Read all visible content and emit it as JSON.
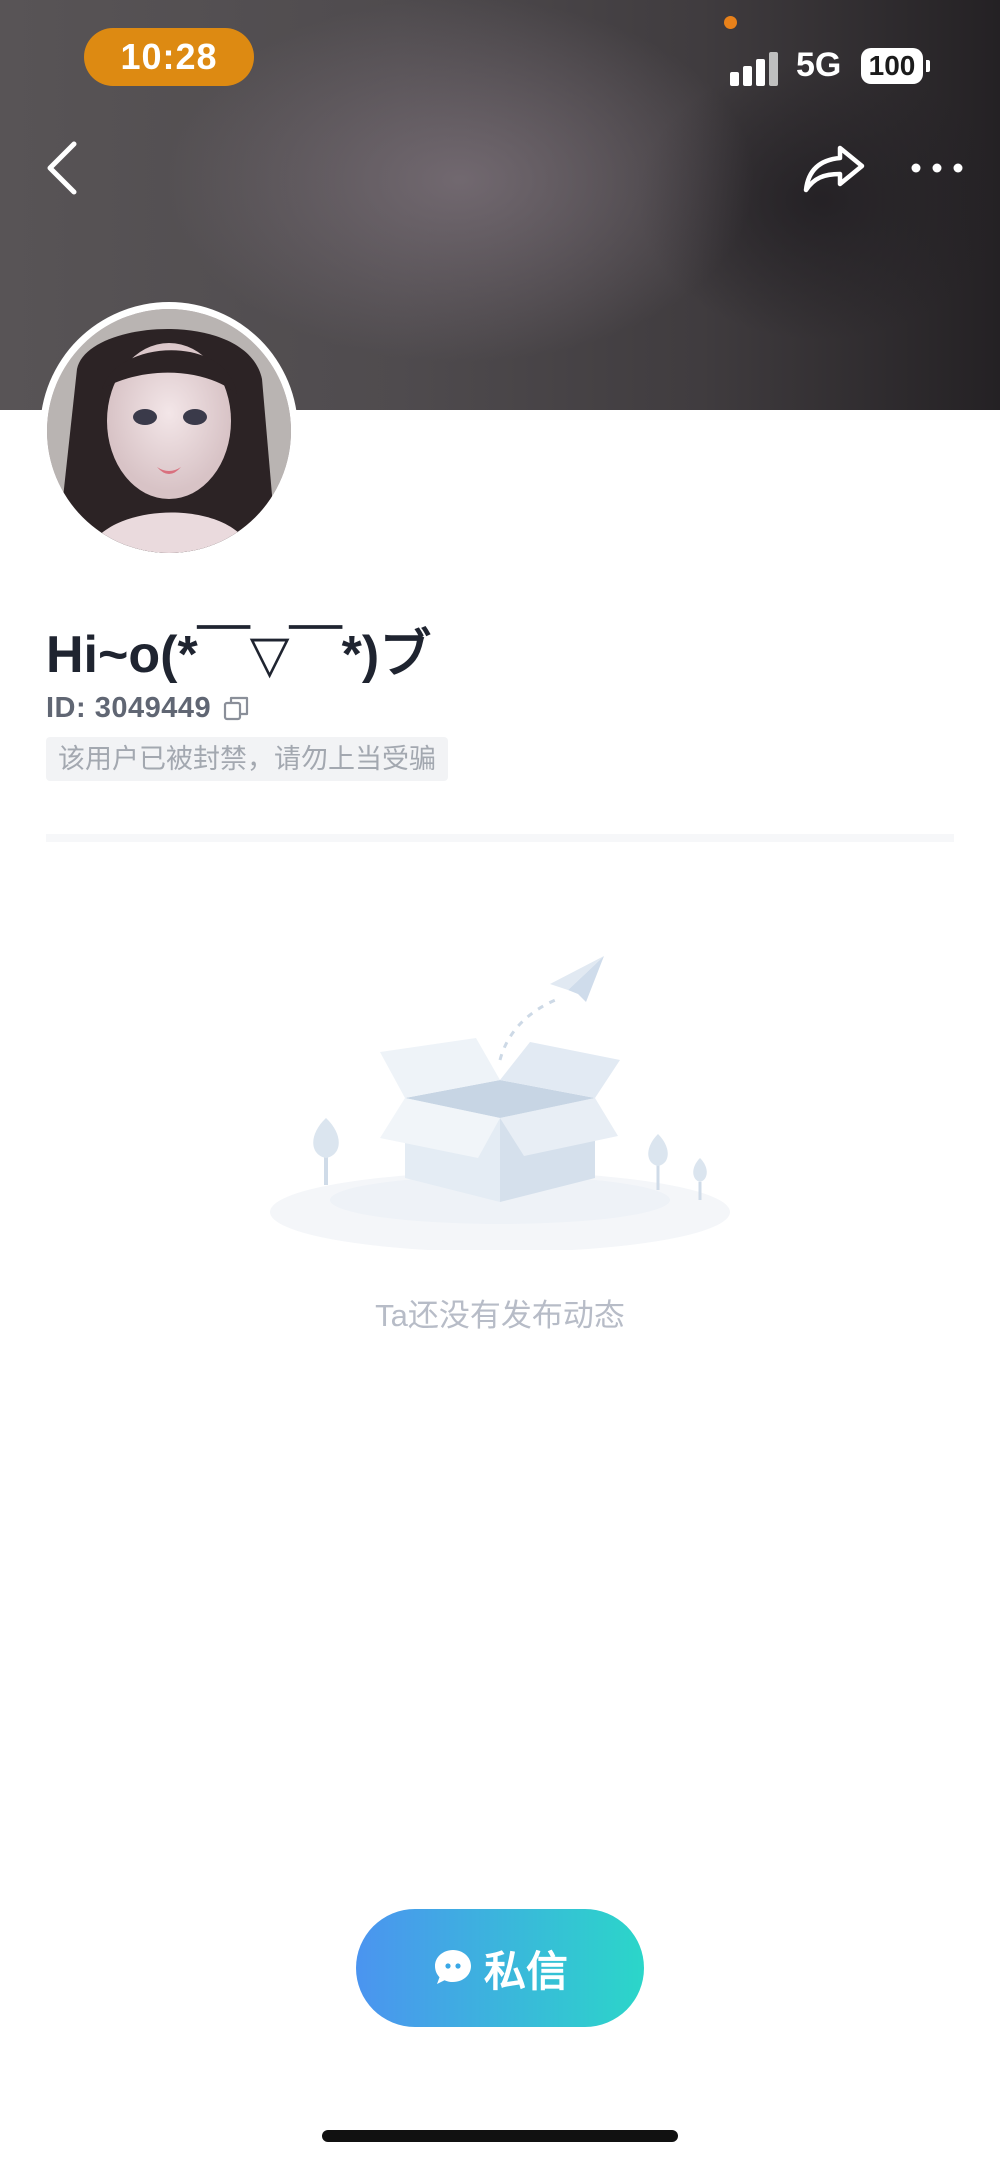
{
  "status_bar": {
    "time": "10:28",
    "network": "5G",
    "battery": "100",
    "icons": [
      "signal-icon",
      "battery-icon"
    ]
  },
  "nav": {
    "icons": [
      "back-icon",
      "share-icon",
      "more-icon"
    ]
  },
  "profile": {
    "nickname": "Hi~o(*￣▽￣*)ブ",
    "id_text": "ID: 3049449",
    "ban_notice": "该用户已被封禁，请勿上当受骗"
  },
  "empty_state": {
    "text": "Ta还没有发布动态",
    "icon": "empty-box-icon"
  },
  "actions": {
    "message_label": "私信",
    "message_icon": "chat-bubble-icon"
  },
  "colors": {
    "time_pill": "#dd8a12",
    "button_gradient_start": "#4b94f0",
    "button_gradient_end": "#2bd6c9",
    "ban_text": "#a3a8b0"
  }
}
